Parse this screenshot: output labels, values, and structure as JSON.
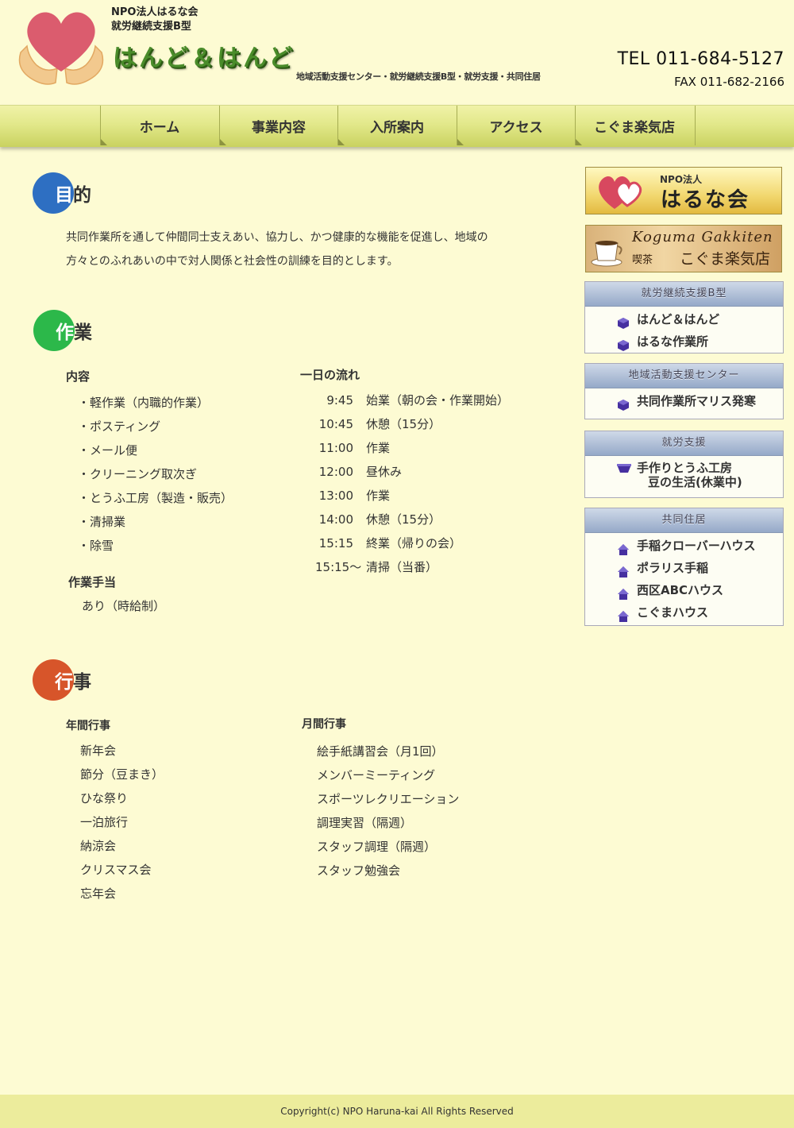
{
  "header": {
    "org_name": "NPO法人はるな会",
    "org_type": "就労継続支援B型",
    "site_title": "はんど＆はんど",
    "tagline": "地域活動支援センター・就労継続支援B型・就労支援・共同住居",
    "tel": "TEL 011-684-5127",
    "fax": "FAX 011-682-2166"
  },
  "nav": [
    "ホーム",
    "事業内容",
    "入所案内",
    "アクセス",
    "こぐま楽気店"
  ],
  "purpose": {
    "title_lead": "目",
    "title_rest": "的",
    "color": "#2e6fc2",
    "text_line1": "共同作業所を通して仲間同士支えあい、協力し、かつ健康的な機能を促進し、地域の",
    "text_line2": "方々とのふれあいの中で対人関係と社会性の訓練を目的とします。"
  },
  "work": {
    "title_lead": "作",
    "title_rest": "業",
    "color": "#2cb84a",
    "content_heading": "内容",
    "content_items": [
      "・軽作業（内職的作業）",
      "・ポスティング",
      "・メール便",
      "・クリーニング取次ぎ",
      "・とうふ工房（製造・販売）",
      "・清掃業",
      "・除雪"
    ],
    "allowance_heading": "作業手当",
    "allowance_text": "あり（時給制）",
    "schedule_heading": "一日の流れ",
    "schedule": [
      {
        "time": "9:45",
        "activity": "始業（朝の会・作業開始）"
      },
      {
        "time": "10:45",
        "activity": "休憩（15分）"
      },
      {
        "time": "11:00",
        "activity": "作業"
      },
      {
        "time": "12:00",
        "activity": "昼休み"
      },
      {
        "time": "13:00",
        "activity": "作業"
      },
      {
        "time": "14:00",
        "activity": "休憩（15分）"
      },
      {
        "time": "15:15",
        "activity": "終業（帰りの会）"
      },
      {
        "time": "15:15～",
        "activity": "清掃（当番）"
      }
    ]
  },
  "events": {
    "title_lead": "行",
    "title_rest": "事",
    "color": "#d7552a",
    "annual_heading": "年間行事",
    "annual": [
      "新年会",
      "節分（豆まき）",
      "ひな祭り",
      "一泊旅行",
      "納涼会",
      "クリスマス会",
      "忘年会"
    ],
    "monthly_heading": "月間行事",
    "monthly": [
      "絵手紙講習会（月1回）",
      "メンバーミーティング",
      "スポーツレクリエーション",
      "調理実習（隔週）",
      "スタッフ調理（隔週）",
      "スタッフ勉強会"
    ]
  },
  "sidebar": {
    "banner_haruna": {
      "small": "NPO法人",
      "large": "はるな会"
    },
    "banner_koguma": {
      "script": "Koguma Gakkiten",
      "small": "喫茶",
      "large": "こぐま楽気店"
    },
    "boxes": [
      {
        "heading": "就労継続支援B型",
        "items": [
          "はんど＆はんど",
          "はるな作業所"
        ]
      },
      {
        "heading": "地域活動支援センター",
        "items": [
          "共同作業所マリス発寒"
        ]
      },
      {
        "heading": "就労支援",
        "items": [
          "手作りとうふ工房",
          "豆の生活(休業中)"
        ]
      },
      {
        "heading": "共同住居",
        "items": [
          "手稲クローバーハウス",
          "ポラリス手稲",
          "西区ABCハウス",
          "こぐまハウス"
        ]
      }
    ]
  },
  "footer": {
    "copyright": "Copyright(c) NPO Haruna-kai All Rights Reserved"
  }
}
